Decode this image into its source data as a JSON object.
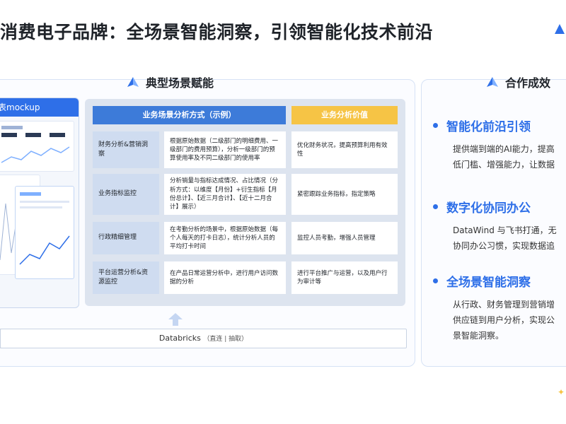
{
  "title": "消费电子品牌：全场景智能洞察，引领智能化技术前沿",
  "colors": {
    "brand": "#2e6fe8",
    "header_blue": "#3d7bd9",
    "header_orange": "#f6c445",
    "label_bg": "#cfdcf0",
    "panel_bg": "#dde4ef"
  },
  "left_section": {
    "heading": "典型场景赋能",
    "heading_icon": "triangle-logo-icon",
    "mockup_label": "表mockup",
    "table": {
      "header_method": "业务场景分析方式（示例）",
      "header_value": "业务分析价值",
      "rows": [
        {
          "label": "财务分析&营销洞察",
          "method": "根据原始数据（二级部门的明细费用、一级部门的费用预算），分析一级部门的预算使用率及不同二级部门的使用率",
          "value": "优化财务状况，提高预算利用有效性"
        },
        {
          "label": "业务指标监控",
          "method": "分析销量与指标达成情况、占比情况（分析方式：以维度【月份】+衍生指标【月份总计】、【近三月合计】、【近十二月合计】展示）",
          "value": "紧密跟踪业务指标，指定策略"
        },
        {
          "label": "行政精细管理",
          "method": "在考勤分析的场景中，根据原始数据（每个人每天的打卡日志），统计分析人员的平均打卡时间",
          "value": "监控人员考勤，增强人员管理"
        },
        {
          "label": "平台运营分析&资源监控",
          "method": "在产品日常运营分析中，进行用户访问数据的分析",
          "value": "进行平台推广与运营，以及用户行为审计等"
        }
      ]
    },
    "databricks_label": "Databricks",
    "databricks_note": "（直连 | 抽取）"
  },
  "right_section": {
    "heading": "合作成效",
    "heading_icon": "triangle-logo-icon",
    "items": [
      {
        "title": "智能化前沿引领",
        "lines": [
          "提供端到端的AI能力，提高",
          "低门槛、增强能力，让数据"
        ]
      },
      {
        "title": "数字化协同办公",
        "lines": [
          "DataWind 与飞书打通，无",
          "协同办公习惯，实现数据追"
        ]
      },
      {
        "title": "全场景智能洞察",
        "lines": [
          "从行政、财务管理到营销增",
          "供应链到用户分析，实现公",
          "景智能洞察。"
        ]
      }
    ]
  }
}
